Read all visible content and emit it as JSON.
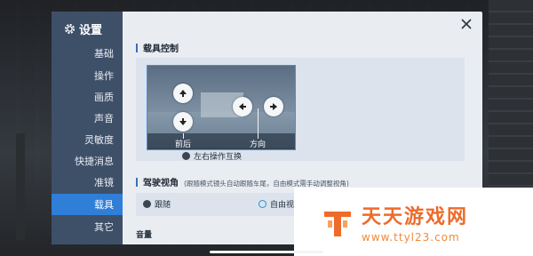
{
  "settings": {
    "title": "设置",
    "nav": [
      {
        "label": "基础"
      },
      {
        "label": "操作"
      },
      {
        "label": "画质"
      },
      {
        "label": "声音"
      },
      {
        "label": "灵敏度"
      },
      {
        "label": "快捷消息"
      },
      {
        "label": "准镜"
      },
      {
        "label": "载具",
        "active": true
      },
      {
        "label": "其它"
      }
    ]
  },
  "vehicle_control": {
    "heading": "载具控制",
    "preview_labels": {
      "forward_back": "前后",
      "direction": "方向"
    },
    "swap_label": "左右操作互换"
  },
  "driving_view": {
    "heading": "驾驶视角",
    "description": "(跟随模式镜头自动跟随车尾，自由模式需手动调整视角)",
    "options": [
      {
        "label": "跟随",
        "selected": true
      },
      {
        "label": "自由视角",
        "selected": false
      }
    ]
  },
  "volume": {
    "heading": "音量"
  },
  "watermark": {
    "name": "天天游戏网",
    "url": "www.ttyl23.com"
  },
  "colors": {
    "sidebar": "#3e4f68",
    "active": "#2f7fd8",
    "panel": "#e9edf2",
    "accent": "#3a6fb8",
    "watermark": "#ee6b2b"
  }
}
